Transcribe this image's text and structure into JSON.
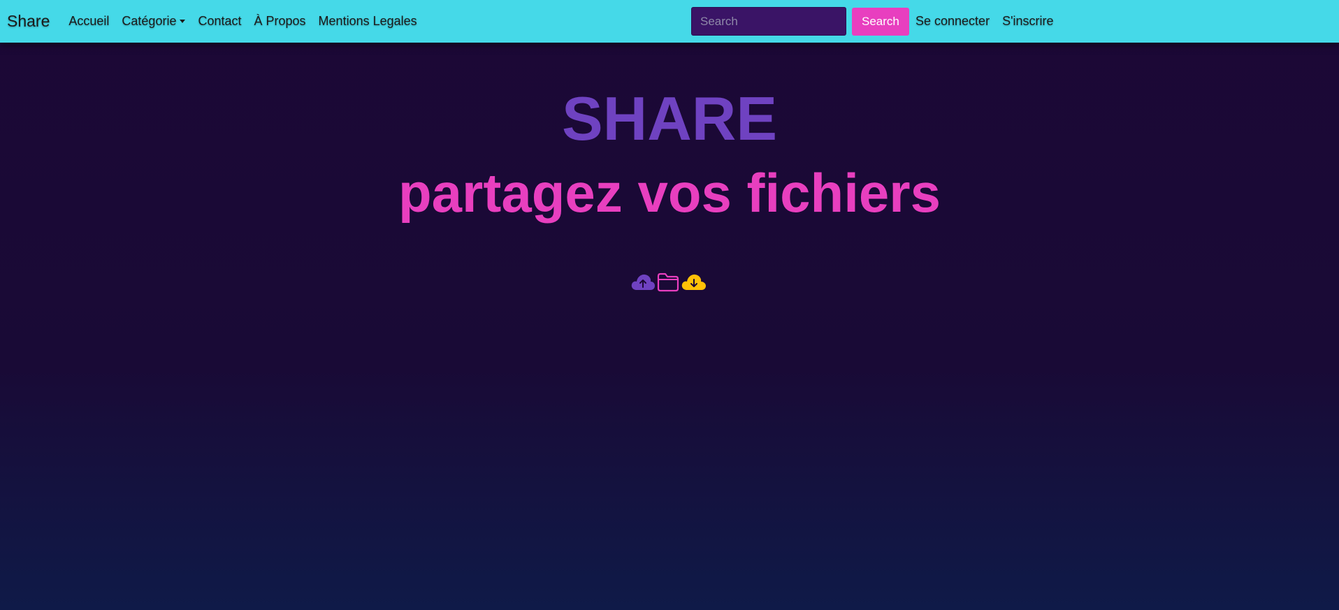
{
  "navbar": {
    "brand": "Share",
    "links": [
      "Accueil",
      "Catégorie",
      "Contact",
      "À Propos",
      "Mentions Legales"
    ],
    "search": {
      "placeholder": "Search",
      "value": "",
      "button_label": "Search"
    },
    "auth": {
      "login": "Se connecter",
      "register": "S'inscrire"
    }
  },
  "hero": {
    "title": "SHARE",
    "subtitle": "partagez vos fichiers"
  },
  "icons": [
    "cloud-upload-icon",
    "folder-icon",
    "cloud-download-icon"
  ],
  "colors": {
    "navbar": "#45d9e8",
    "accent_purple": "#6f42c1",
    "accent_pink": "#e83fbf",
    "accent_yellow": "#ffc107",
    "background": "#1c0836"
  }
}
